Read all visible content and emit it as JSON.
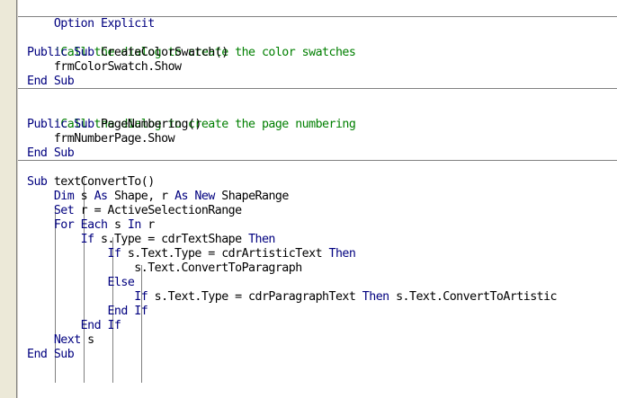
{
  "colors": {
    "keyword": "#00007f",
    "comment": "#007f00",
    "text": "#000000",
    "gutter": "#ece9d8"
  },
  "code": {
    "option": [
      "Option Explicit"
    ],
    "cmt1": [
      "'Call the dialog to create the color swatches"
    ],
    "sub1_decl": [
      "Public Sub",
      " CreateColorSwatch()"
    ],
    "sub1_body": [
      "    frmColorSwatch.Show"
    ],
    "sub1_end": [
      "End Sub"
    ],
    "cmt2": [
      "'Call the dialog to create the page numbering"
    ],
    "sub2_decl": [
      "Public Sub",
      " PageNumbering()"
    ],
    "sub2_body": [
      "    frmNumberPage.Show"
    ],
    "sub2_end": [
      "End Sub"
    ],
    "sub3_decl": [
      "Sub",
      " textConvertTo()"
    ],
    "dim": [
      "    ",
      "Dim",
      " s ",
      "As",
      " Shape, r ",
      "As New",
      " ShapeRange"
    ],
    "set": [
      "    ",
      "Set",
      " r = ActiveSelectionRange"
    ],
    "for": [
      "    ",
      "For Each",
      " s ",
      "In",
      " r"
    ],
    "if1": [
      "        ",
      "If",
      " s.Type = cdrTextShape ",
      "Then"
    ],
    "if2": [
      "            ",
      "If",
      " s.Text.Type = cdrArtisticText ",
      "Then"
    ],
    "conv1": [
      "                s.Text.ConvertToParagraph"
    ],
    "else": [
      "            ",
      "Else"
    ],
    "if3": [
      "                ",
      "If",
      " s.Text.Type = cdrParagraphText ",
      "Then",
      " s.Text.ConvertToArtistic"
    ],
    "endif1": [
      "            ",
      "End If"
    ],
    "endif2": [
      "        ",
      "End If"
    ],
    "next": [
      "    ",
      "Next",
      " s"
    ],
    "sub3_end": [
      "End Sub"
    ]
  }
}
